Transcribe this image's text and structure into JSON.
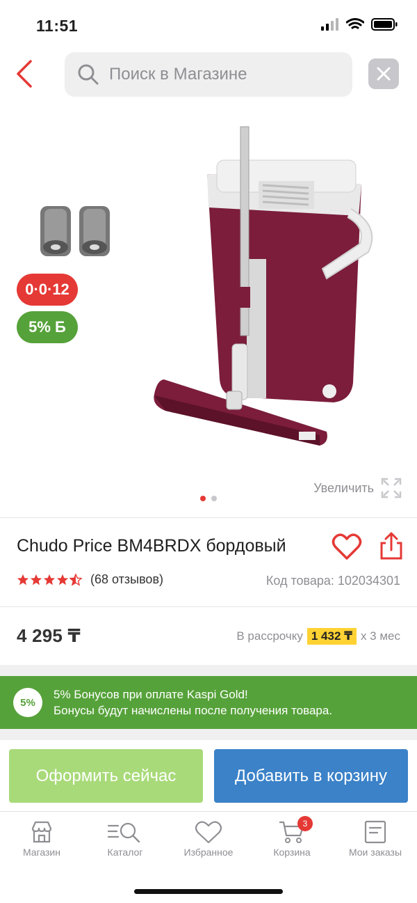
{
  "status_bar": {
    "time": "11:51"
  },
  "search": {
    "placeholder": "Поиск в Магазине"
  },
  "gallery": {
    "badges": {
      "installment": "0·0·12",
      "bonus": "5% Б"
    },
    "zoom_label": "Увеличить",
    "pages": 2,
    "active_page": 1
  },
  "product": {
    "title": "Chudo Price BM4BRDX бордовый",
    "rating": 4.5,
    "reviews": "(68 отзывов)",
    "sku": "Код товара: 102034301",
    "price": "4 295 ₸",
    "installment": {
      "prefix": "В рассрочку",
      "amount": "1 432 ₸",
      "suffix": "х 3 мес"
    }
  },
  "bonus_banner": {
    "circle": "5%",
    "line1": "5% Бонусов при оплате Kaspi Gold!",
    "line2": "Бонусы будут начислены после получения товара."
  },
  "actions": {
    "checkout": "Оформить сейчас",
    "add_to_cart": "Добавить в корзину"
  },
  "tabbar": {
    "shop": "Магазин",
    "catalog": "Каталог",
    "favorites": "Избранное",
    "cart": "Корзина",
    "cart_count": "3",
    "orders": "Мои заказы"
  },
  "colors": {
    "accent_red": "#e53935",
    "bonus_green": "#56a23a",
    "cart_blue": "#3b82c8",
    "checkout_green": "#a8da79",
    "highlight_yellow": "#ffd233"
  },
  "product_colors": {
    "bucket": "#7b1d3b",
    "handle": "#e8e8e8"
  }
}
